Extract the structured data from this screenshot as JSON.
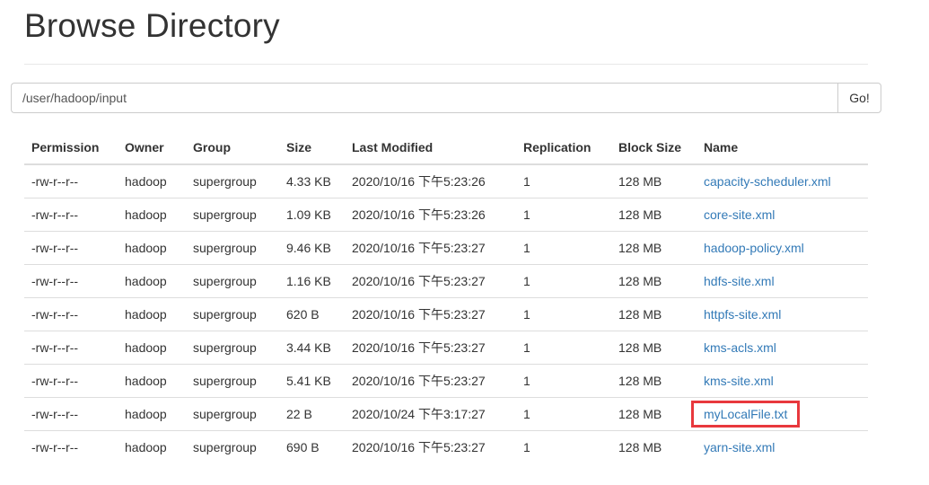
{
  "page": {
    "title": "Browse Directory"
  },
  "path_bar": {
    "value": "/user/hadoop/input",
    "go_label": "Go!"
  },
  "table": {
    "headers": [
      "Permission",
      "Owner",
      "Group",
      "Size",
      "Last Modified",
      "Replication",
      "Block Size",
      "Name"
    ],
    "rows": [
      {
        "permission": "-rw-r--r--",
        "owner": "hadoop",
        "group": "supergroup",
        "size": "4.33 KB",
        "modified": "2020/10/16 下午5:23:26",
        "replication": "1",
        "block_size": "128 MB",
        "name": "capacity-scheduler.xml"
      },
      {
        "permission": "-rw-r--r--",
        "owner": "hadoop",
        "group": "supergroup",
        "size": "1.09 KB",
        "modified": "2020/10/16 下午5:23:26",
        "replication": "1",
        "block_size": "128 MB",
        "name": "core-site.xml"
      },
      {
        "permission": "-rw-r--r--",
        "owner": "hadoop",
        "group": "supergroup",
        "size": "9.46 KB",
        "modified": "2020/10/16 下午5:23:27",
        "replication": "1",
        "block_size": "128 MB",
        "name": "hadoop-policy.xml"
      },
      {
        "permission": "-rw-r--r--",
        "owner": "hadoop",
        "group": "supergroup",
        "size": "1.16 KB",
        "modified": "2020/10/16 下午5:23:27",
        "replication": "1",
        "block_size": "128 MB",
        "name": "hdfs-site.xml"
      },
      {
        "permission": "-rw-r--r--",
        "owner": "hadoop",
        "group": "supergroup",
        "size": "620 B",
        "modified": "2020/10/16 下午5:23:27",
        "replication": "1",
        "block_size": "128 MB",
        "name": "httpfs-site.xml"
      },
      {
        "permission": "-rw-r--r--",
        "owner": "hadoop",
        "group": "supergroup",
        "size": "3.44 KB",
        "modified": "2020/10/16 下午5:23:27",
        "replication": "1",
        "block_size": "128 MB",
        "name": "kms-acls.xml"
      },
      {
        "permission": "-rw-r--r--",
        "owner": "hadoop",
        "group": "supergroup",
        "size": "5.41 KB",
        "modified": "2020/10/16 下午5:23:27",
        "replication": "1",
        "block_size": "128 MB",
        "name": "kms-site.xml"
      },
      {
        "permission": "-rw-r--r--",
        "owner": "hadoop",
        "group": "supergroup",
        "size": "22 B",
        "modified": "2020/10/24 下午3:17:27",
        "replication": "1",
        "block_size": "128 MB",
        "name": "myLocalFile.txt",
        "highlighted": true
      },
      {
        "permission": "-rw-r--r--",
        "owner": "hadoop",
        "group": "supergroup",
        "size": "690 B",
        "modified": "2020/10/16 下午5:23:27",
        "replication": "1",
        "block_size": "128 MB",
        "name": "yarn-site.xml"
      }
    ]
  },
  "colors": {
    "link": "#337ab7",
    "highlight_border": "#e8383d",
    "rule": "#dddddd"
  }
}
